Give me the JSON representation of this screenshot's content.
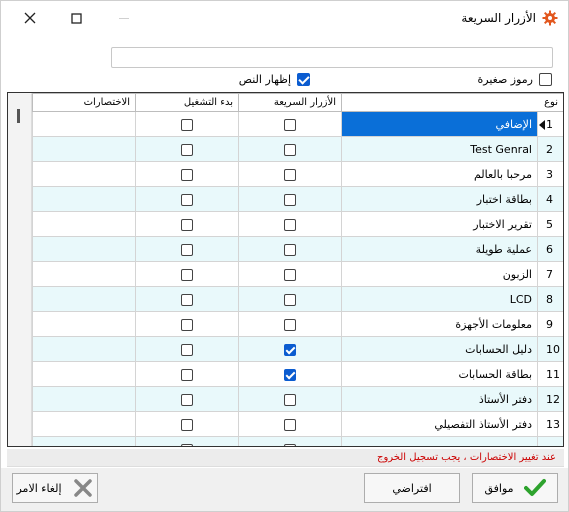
{
  "window": {
    "title": "الأزرار السريعة",
    "icon": "gear-icon",
    "close_icon": "close-icon",
    "maximize_icon": "maximize-icon"
  },
  "search": {
    "value": "",
    "placeholder": ""
  },
  "options": {
    "small_icons_label": "رموز صغيرة",
    "small_icons_checked": false,
    "show_text_label": "إظهار النص",
    "show_text_checked": true
  },
  "grid": {
    "columns": {
      "type": "نوع",
      "quick_buttons": "الأزرار السريعة",
      "startup": "بدء التشغيل",
      "shortcuts": "الاختصارات"
    },
    "rows": [
      {
        "num": "1",
        "name": "الإضافي",
        "quick": false,
        "startup": false,
        "shortcut": "",
        "selected": true
      },
      {
        "num": "2",
        "name": "Test Genral",
        "quick": false,
        "startup": false,
        "shortcut": ""
      },
      {
        "num": "3",
        "name": "مرحبا بالعالم",
        "quick": false,
        "startup": false,
        "shortcut": ""
      },
      {
        "num": "4",
        "name": "بطاقة اختبار",
        "quick": false,
        "startup": false,
        "shortcut": ""
      },
      {
        "num": "5",
        "name": "تقرير الاختبار",
        "quick": false,
        "startup": false,
        "shortcut": ""
      },
      {
        "num": "6",
        "name": "عملية طويلة",
        "quick": false,
        "startup": false,
        "shortcut": ""
      },
      {
        "num": "7",
        "name": "الزبون",
        "quick": false,
        "startup": false,
        "shortcut": ""
      },
      {
        "num": "8",
        "name": "LCD",
        "quick": false,
        "startup": false,
        "shortcut": ""
      },
      {
        "num": "9",
        "name": "معلومات الأجهزة",
        "quick": false,
        "startup": false,
        "shortcut": ""
      },
      {
        "num": "10",
        "name": "دليل الحسابات",
        "quick": true,
        "startup": false,
        "shortcut": ""
      },
      {
        "num": "11",
        "name": "بطاقة الحسابات",
        "quick": true,
        "startup": false,
        "shortcut": ""
      },
      {
        "num": "12",
        "name": "دفتر الأستاذ",
        "quick": false,
        "startup": false,
        "shortcut": ""
      },
      {
        "num": "13",
        "name": "دفتر الأستاذ التفصيلي",
        "quick": false,
        "startup": false,
        "shortcut": ""
      },
      {
        "num": "",
        "name": "",
        "quick": false,
        "startup": false,
        "shortcut": ""
      }
    ]
  },
  "status_message": "عند تغيير الاختصارات ، يجب تسجيل الخروج",
  "buttons": {
    "ok": "موافق",
    "default": "افتراضي",
    "cancel": "إلغاء الامر"
  },
  "colors": {
    "selection": "#0a6fd8",
    "alt_row": "#e9f9fb",
    "check": "#0b5cd0",
    "status_text": "#cc0000",
    "ok_icon": "#2ea32e",
    "cancel_icon": "#888888"
  }
}
